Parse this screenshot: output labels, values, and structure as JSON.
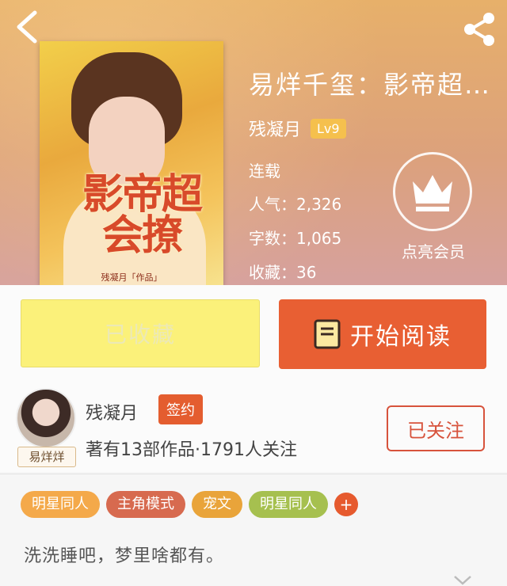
{
  "header": {
    "book_title": "易烊千玺：影帝超…",
    "author_name": "残凝月",
    "level_badge": "Lv9",
    "stats": {
      "status": "连载",
      "popularity": "人气：2,326",
      "word_count": "字数：1,065",
      "favorites": "收藏：36"
    },
    "vip_label": "点亮会员",
    "cover_title": "影帝超会撩",
    "cover_subtitle": "残凝月「作品」"
  },
  "actions": {
    "collected_label": "已收藏",
    "read_label": "开始阅读"
  },
  "author_card": {
    "name": "残凝月",
    "sign_badge": "签约",
    "description": "著有13部作品·1791人关注",
    "follow_label": "已关注",
    "avatar_tag": "易烊烊"
  },
  "tags": [
    {
      "label": "明星同人",
      "color": "#f4a94a"
    },
    {
      "label": "主角模式",
      "color": "#d76a4f"
    },
    {
      "label": "宠文",
      "color": "#e9a43a"
    },
    {
      "label": "明星同人",
      "color": "#a6c04f"
    }
  ],
  "tag_add_label": "+",
  "intro": "洗洗睡吧，梦里啥都有。",
  "icons": {
    "back": "chevron-left-icon",
    "share": "share-icon",
    "vip": "crown-icon",
    "read": "book-icon",
    "expand": "chevron-down-icon"
  }
}
